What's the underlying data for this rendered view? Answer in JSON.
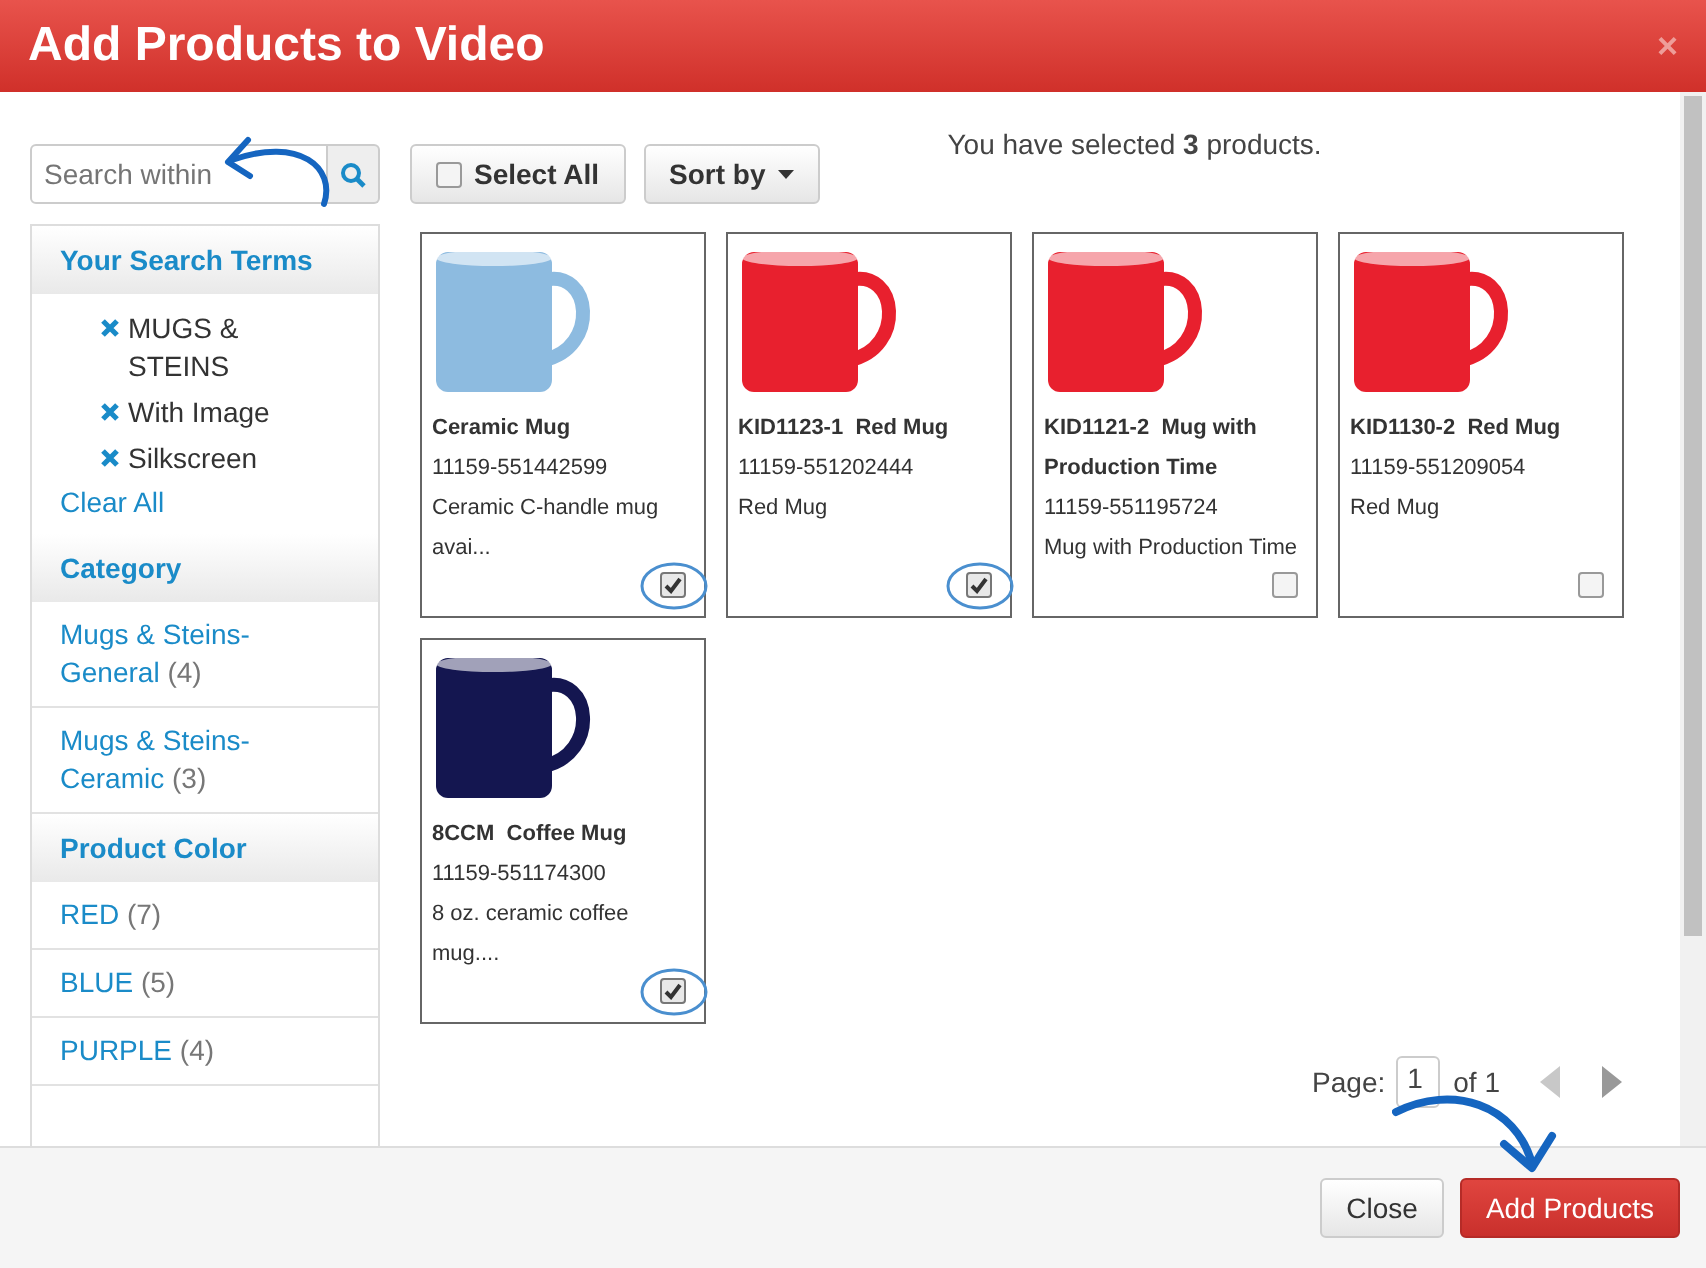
{
  "dialog": {
    "title": "Add Products to Video",
    "close": "×"
  },
  "search": {
    "placeholder": "Search within"
  },
  "sidebar": [
    {
      "kind": "terms",
      "title": "Your Search Terms",
      "items": [
        {
          "label": "MUGS & STEINS"
        },
        {
          "label": "With Image"
        },
        {
          "label": "Silkscreen"
        }
      ],
      "link": "Clear All"
    },
    {
      "kind": "facets",
      "title": "Category",
      "items": [
        {
          "label": "Mugs & Steins-General",
          "count": "(4)"
        },
        {
          "label": "Mugs & Steins-Ceramic",
          "count": "(3)"
        }
      ]
    },
    {
      "kind": "facets",
      "title": "Product Color",
      "items": [
        {
          "label": "RED",
          "count": "(7)"
        },
        {
          "label": "BLUE",
          "count": "(5)"
        },
        {
          "label": "PURPLE",
          "count": "(4)"
        }
      ]
    }
  ],
  "toolbar": {
    "select_all": {
      "label": "Select All",
      "checked": false
    },
    "sort": "Sort by"
  },
  "selection_note": {
    "before": "You have selected ",
    "count": "3",
    "after": " products."
  },
  "products": [
    {
      "title": "Ceramic Mug",
      "sku": "11159-551442599",
      "description": "Ceramic C-handle mug avai...",
      "color": "#8dbbe0",
      "checked": true,
      "circled": true
    },
    {
      "title": "KID1123-1  Red Mug",
      "sku": "11159-551202444",
      "description": "Red Mug",
      "color": "#e8202e",
      "checked": true,
      "circled": true
    },
    {
      "title": "KID1121-2  Mug with Production Time",
      "sku": "11159-551195724",
      "description": "Mug with Production Time",
      "color": "#e8202e",
      "checked": false,
      "circled": false
    },
    {
      "title": "KID1130-2  Red Mug",
      "sku": "11159-551209054",
      "description": "Red Mug",
      "color": "#e8202e",
      "checked": false,
      "circled": false
    },
    {
      "title": "8CCM  Coffee Mug",
      "sku": "11159-551174300",
      "description": "8 oz. ceramic coffee mug....",
      "color": "#141650",
      "checked": true,
      "circled": true
    }
  ],
  "pagination": {
    "label": "Page:",
    "page": "1",
    "of": "of 1",
    "prev_disabled": true,
    "next_disabled": false
  },
  "footer": {
    "close": "Close",
    "submit": "Add Products"
  }
}
